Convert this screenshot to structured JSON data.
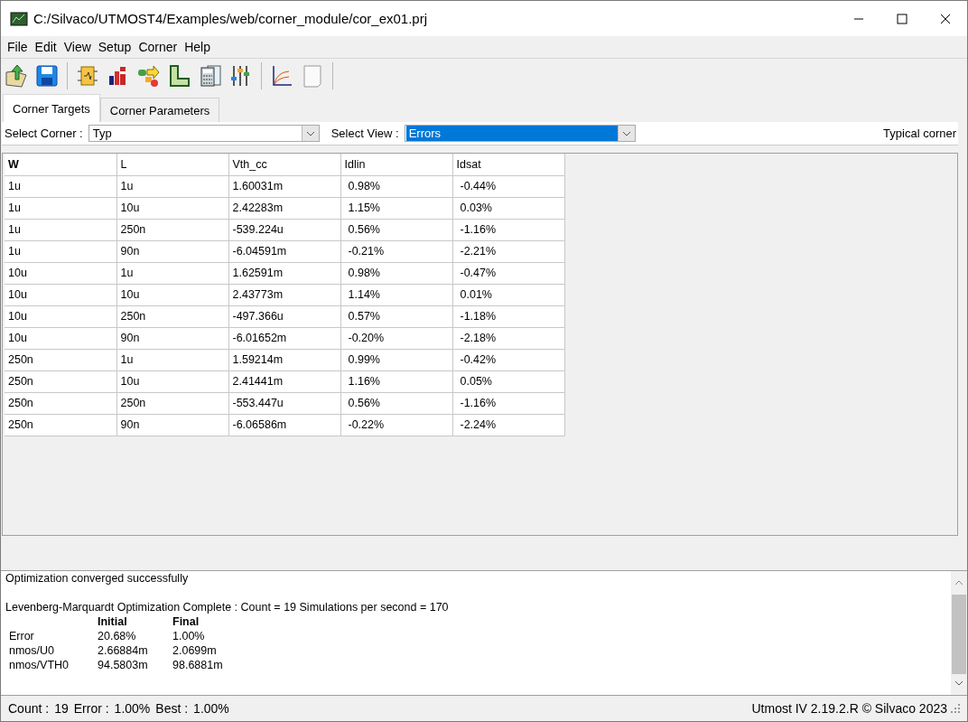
{
  "window": {
    "title": "C:/Silvaco/UTMOST4/Examples/web/corner_module/cor_ex01.prj"
  },
  "menu": [
    "File",
    "Edit",
    "View",
    "Setup",
    "Corner",
    "Help"
  ],
  "tabs": [
    {
      "label": "Corner Targets",
      "selected": true
    },
    {
      "label": "Corner Parameters",
      "selected": false
    }
  ],
  "corner_select": {
    "label": "Select Corner :",
    "value": "Typ",
    "focused": false
  },
  "view_select": {
    "label": "Select View :",
    "value": "Errors",
    "focused": true
  },
  "corner_description": "Typical corner",
  "table": {
    "columns": [
      "W",
      "L",
      "Vth_cc",
      "Idlin",
      "Idsat"
    ],
    "rows": [
      [
        "1u",
        "1u",
        "1.60031m",
        "0.98%",
        "-0.44%"
      ],
      [
        "1u",
        "10u",
        "2.42283m",
        "1.15%",
        "0.03%"
      ],
      [
        "1u",
        "250n",
        "-539.224u",
        "0.56%",
        "-1.16%"
      ],
      [
        "1u",
        "90n",
        "-6.04591m",
        "-0.21%",
        "-2.21%"
      ],
      [
        "10u",
        "1u",
        "1.62591m",
        "0.98%",
        "-0.47%"
      ],
      [
        "10u",
        "10u",
        "2.43773m",
        "1.14%",
        "0.01%"
      ],
      [
        "10u",
        "250n",
        "-497.366u",
        "0.57%",
        "-1.18%"
      ],
      [
        "10u",
        "90n",
        "-6.01652m",
        "-0.20%",
        "-2.18%"
      ],
      [
        "250n",
        "1u",
        "1.59214m",
        "0.99%",
        "-0.42%"
      ],
      [
        "250n",
        "10u",
        "2.41441m",
        "1.16%",
        "0.05%"
      ],
      [
        "250n",
        "250n",
        "-553.447u",
        "0.56%",
        "-1.16%"
      ],
      [
        "250n",
        "90n",
        "-6.06586m",
        "-0.22%",
        "-2.24%"
      ]
    ]
  },
  "log": {
    "lines": [
      "Optimization converged successfully",
      "Levenberg-Marquardt Optimization Complete : Count = 19  Simulations per second = 170"
    ],
    "summary": {
      "columns": [
        "",
        "Initial",
        "Final"
      ],
      "rows": [
        [
          "Error",
          "20.68%",
          "1.00%"
        ],
        [
          "nmos/U0",
          "2.66884m",
          "2.0699m"
        ],
        [
          "nmos/VTH0",
          "94.5803m",
          "98.6881m"
        ]
      ]
    }
  },
  "status_bar": {
    "count_label": "Count :",
    "count": "19",
    "error_label": "Error :",
    "error": "1.00%",
    "best_label": "Best :",
    "best": "1.00%",
    "version": "Utmost IV 2.19.2.R © Silvaco 2023"
  }
}
